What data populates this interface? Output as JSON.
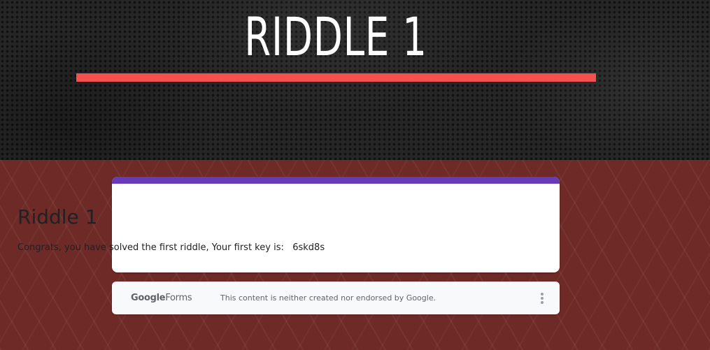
{
  "header": {
    "title": "RIDDLE 1",
    "rule_color": "#f2514f"
  },
  "form": {
    "title": "Riddle 1",
    "description": "Congrats, you have solved the first riddle, Your first key is:   6skd8s",
    "accent_color": "#673ab7"
  },
  "footer": {
    "logo_google": "Google",
    "logo_forms": "Forms",
    "disclaimer": "This content is neither created nor endorsed by Google.",
    "menu_icon": "more-vert-icon"
  },
  "theme": {
    "header_bg": "#262626",
    "body_bg": "#6e2a27"
  }
}
